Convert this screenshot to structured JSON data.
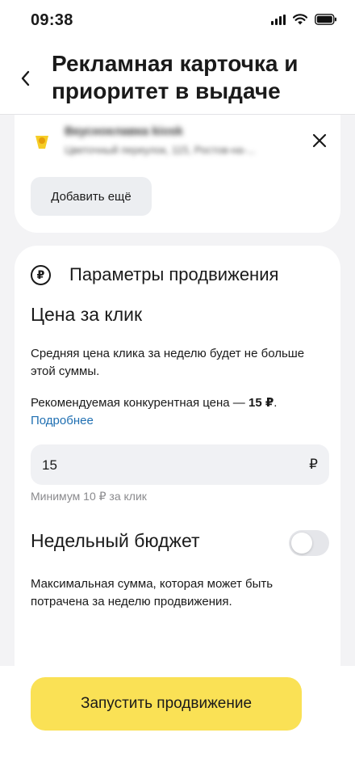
{
  "status_bar": {
    "time": "09:38"
  },
  "header": {
    "title": "Рекламная карточка и приоритет в выдаче"
  },
  "business": {
    "name": "Вкусноелавка kiosk",
    "address": "Цветочный переулок, 115, Ростов-на-...",
    "add_more_label": "Добавить ещё"
  },
  "promotion": {
    "section_title": "Параметры продвижения",
    "currency_symbol": "₽",
    "price": {
      "heading": "Цена за клик",
      "description": "Средняя цена клика за неделю будет не больше этой суммы.",
      "recommend_prefix": "Рекомендуемая конкурентная цена — ",
      "recommend_value": "15 ₽",
      "recommend_suffix": ".",
      "more_link": "Подробнее",
      "input_value": "15",
      "input_currency": "₽",
      "min_hint": "Минимум 10 ₽ за клик"
    },
    "budget": {
      "heading": "Недельный бюджет",
      "enabled": false,
      "description": "Максимальная сумма, которая может быть потрачена за неделю продвижения."
    }
  },
  "footer": {
    "launch_label": "Запустить продвижение"
  },
  "colors": {
    "accent_yellow": "#fae155",
    "link_blue": "#1f6fb2",
    "background": "#f3f3f5"
  }
}
